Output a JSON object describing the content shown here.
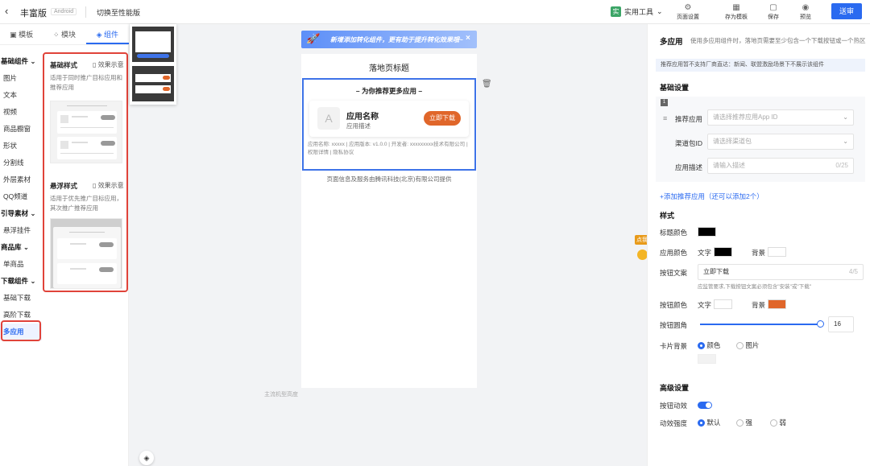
{
  "topbar": {
    "title": "丰富版",
    "platform": "Android",
    "switch_label": "切换至性能版",
    "tools_label": "实用工具",
    "tools_logo": "实",
    "page_settings": "页面设置",
    "save_template": "存为模板",
    "save": "保存",
    "preview": "预览",
    "submit": "送审"
  },
  "left_tabs": [
    "模板",
    "模块",
    "组件"
  ],
  "categories": [
    {
      "label": "基础组件",
      "group": true
    },
    {
      "label": "图片"
    },
    {
      "label": "文本"
    },
    {
      "label": "视频"
    },
    {
      "label": "商品橱窗"
    },
    {
      "label": "形状"
    },
    {
      "label": "分割线"
    },
    {
      "label": "外层素材"
    },
    {
      "label": "QQ频道"
    },
    {
      "label": "引导素材",
      "group": true
    },
    {
      "label": "悬浮挂件"
    },
    {
      "label": "商品库",
      "group": true
    },
    {
      "label": "单商品"
    },
    {
      "label": "下载组件",
      "group": true
    },
    {
      "label": "基础下载"
    },
    {
      "label": "高阶下载"
    },
    {
      "label": "多应用",
      "active": true
    }
  ],
  "styles_panel": {
    "basic_title": "基础样式",
    "basic_effect": "效果示意",
    "basic_desc": "适用于同时推广目标应用和推荐应用",
    "float_title": "悬浮样式",
    "float_effect": "效果示意",
    "float_desc": "适用于优先推广目标应用，其次推广推荐应用"
  },
  "canvas": {
    "banner": "新增添加转化组件，更有助于提升转化效果哦~",
    "page_title": "落地页标题",
    "module_heading": "– 为你推荐更多应用 –",
    "app_name": "应用名称",
    "app_desc": "应用描述",
    "download_btn": "立即下载",
    "app_meta_1": "应用名称: xxxxx | 应用版本: v1.0.0 | 开发者: xxxxxxxxx技术有限公司 |",
    "app_meta_2": "权限详情 | 隐私协议",
    "footer": "页面信息及服务由腾讯科技(北京)有限公司提供",
    "hint": "主流机型高度"
  },
  "right": {
    "title": "多应用",
    "subtitle": "使用多应用组件时，落地页需要至少包含一个下载按钮或一个热区",
    "notice": "推荐应用暂不支持厂商直达：新闻、联盟激励场景下不展示该组件",
    "basic_settings": "基础设置",
    "index": "1",
    "rec_app_label": "推荐应用",
    "rec_app_placeholder": "请选择推荐应用App ID",
    "channel_label": "渠道包ID",
    "channel_placeholder": "请选择渠道包",
    "desc_label": "应用描述",
    "desc_placeholder": "请输入描述",
    "desc_count": "0/25",
    "add_link": "+添加推荐应用（还可以添加2个）",
    "style_head": "样式",
    "title_color_label": "标题颜色",
    "app_color_label": "应用颜色",
    "text_label": "文字",
    "bg_label": "背景",
    "btn_text_label": "按钮文案",
    "btn_text_value": "立即下载",
    "btn_text_count": "4/5",
    "btn_text_hint": "应监管要求,下载按钮文案必须包含\"安装\"或\"下载\"",
    "btn_color_label": "按钮颜色",
    "radius_label": "按钮圆角",
    "radius_value": "16",
    "card_bg_label": "卡片背景",
    "opt_color": "颜色",
    "opt_image": "图片",
    "advanced": "高级设置",
    "anim_label": "按钮动效",
    "intensity_label": "动效强度",
    "opt_default": "默认",
    "opt_strong": "强",
    "opt_weak": "弱"
  },
  "colors": {
    "accent": "#2a6af0",
    "download": "#e0662a",
    "title_color": "#000000",
    "app_text_color": "#000000",
    "app_bg_color": "#ffffff",
    "btn_text_color": "#ffffff",
    "btn_bg_color": "#e0662a"
  },
  "float_badge": "点我"
}
